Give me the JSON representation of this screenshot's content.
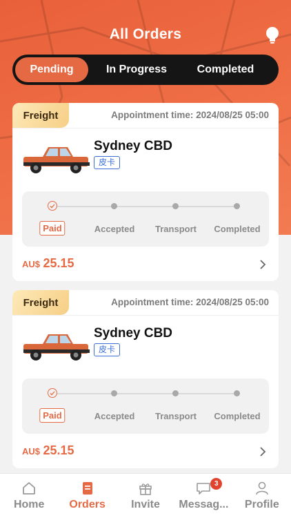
{
  "header": {
    "title": "All Orders"
  },
  "tabs": [
    {
      "label": "Pending",
      "active": true
    },
    {
      "label": "In Progress",
      "active": false
    },
    {
      "label": "Completed",
      "active": false
    }
  ],
  "orders": [
    {
      "tag": "Freight",
      "appointment": "Appointment time: 2024/08/25 05:00",
      "destination": "Sydney CBD",
      "vehicle_type": "皮卡",
      "steps": [
        "Paid",
        "Accepted",
        "Transport",
        "Completed"
      ],
      "current_step": "Paid",
      "currency": "AU$",
      "amount": "25.15"
    },
    {
      "tag": "Freight",
      "appointment": "Appointment time: 2024/08/25 05:00",
      "destination": "Sydney CBD",
      "vehicle_type": "皮卡",
      "steps": [
        "Paid",
        "Accepted",
        "Transport",
        "Completed"
      ],
      "current_step": "Paid",
      "currency": "AU$",
      "amount": "25.15"
    }
  ],
  "bottom_nav": [
    {
      "label": "Home",
      "icon": "home-icon",
      "active": false
    },
    {
      "label": "Orders",
      "icon": "orders-icon",
      "active": true
    },
    {
      "label": "Invite",
      "icon": "gift-icon",
      "active": false
    },
    {
      "label": "Messag...",
      "icon": "message-icon",
      "active": false,
      "badge": "3"
    },
    {
      "label": "Profile",
      "icon": "profile-icon",
      "active": false
    }
  ],
  "colors": {
    "accent": "#e56a44",
    "tab_bar": "#151515",
    "badge": "#e0442f",
    "link_blue": "#3b6fd6"
  }
}
